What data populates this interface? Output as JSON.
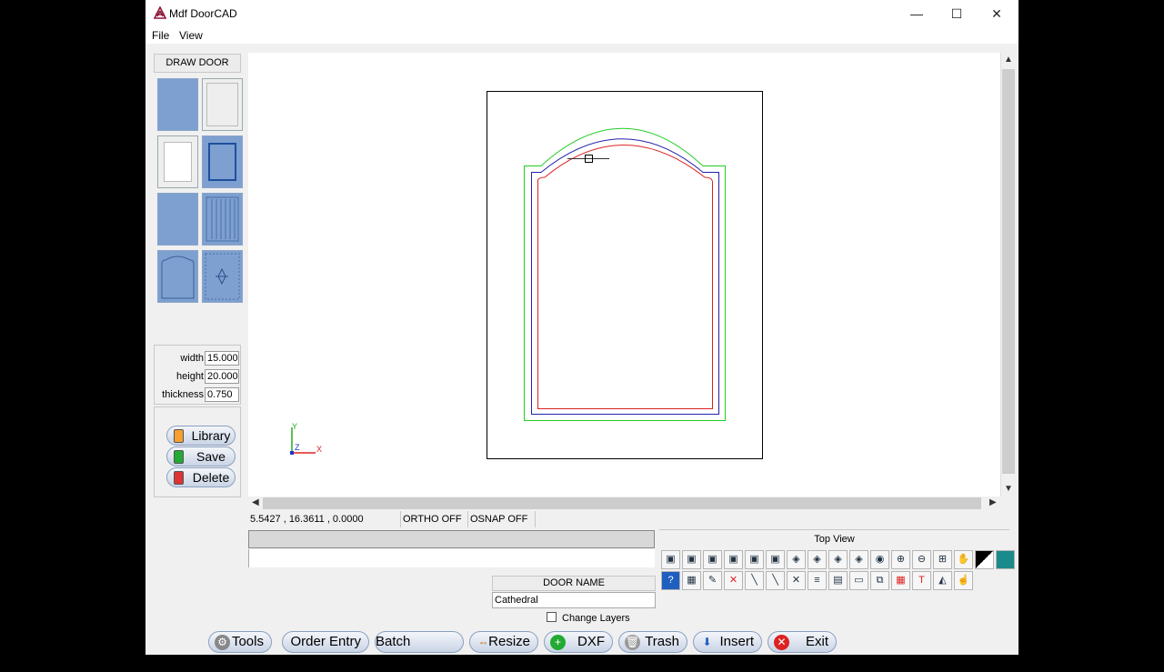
{
  "window": {
    "title": "Mdf DoorCAD",
    "minimize": "—",
    "maximize": "☐",
    "close": "✕"
  },
  "menu": {
    "items": [
      "File",
      "View"
    ]
  },
  "sidebar": {
    "draw_door_label": "DRAW DOOR",
    "door_styles": [
      {
        "name": "slab-door"
      },
      {
        "name": "flat-panel-door"
      },
      {
        "name": "shaker-door"
      },
      {
        "name": "raised-panel-door"
      },
      {
        "name": "tall-door"
      },
      {
        "name": "beadboard-door"
      },
      {
        "name": "cathedral-door"
      },
      {
        "name": "diamond-door"
      }
    ],
    "dims": {
      "width_label": "width",
      "width_value": "15.000",
      "height_label": "height",
      "height_value": "20.000",
      "thickness_label": "thickness",
      "thickness_value": "0.750"
    },
    "library_buttons": {
      "library": "Library",
      "save": "Save",
      "delete": "Delete"
    }
  },
  "canvas": {
    "axis": {
      "y": "Y",
      "z": "Z",
      "x": "X"
    }
  },
  "status": {
    "coords": "5.5427 , 16.3611 , 0.0000",
    "ortho": "ORTHO OFF",
    "osnap": "OSNAP OFF"
  },
  "door_name": {
    "label": "DOOR NAME",
    "value": "Cathedral"
  },
  "change_layers": "Change Layers",
  "view": {
    "label": "Top View"
  },
  "bottom_buttons": {
    "tools": "Tools",
    "order_entry": "Order Entry",
    "batch_orders": "Batch Orders",
    "resize": "Resize",
    "dxf": "DXF",
    "trash": "Trash",
    "insert": "Insert",
    "exit": "Exit"
  },
  "colors": {
    "outer_profile": "#22cc22",
    "mid_profile": "#2222aa",
    "inner_profile": "#dd2222",
    "accent_blue": "#7ea0d0"
  }
}
